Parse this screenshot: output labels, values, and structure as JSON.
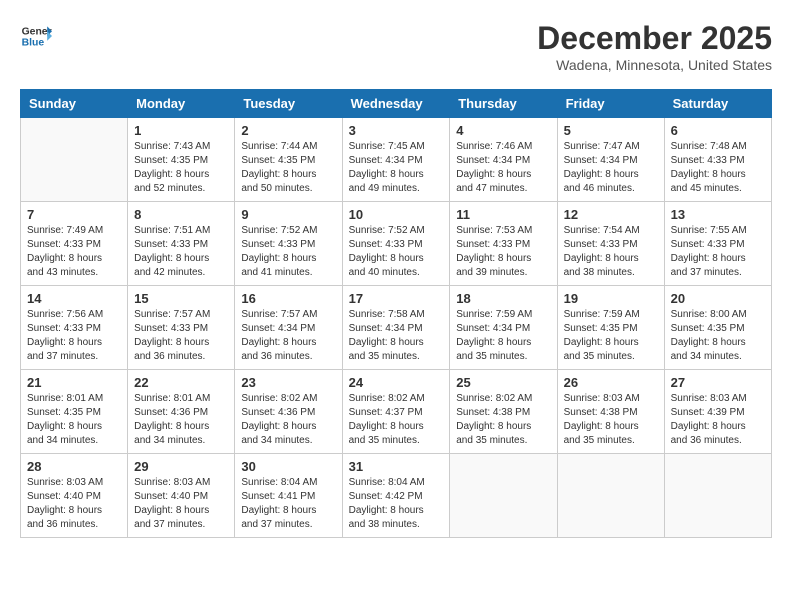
{
  "header": {
    "logo_line1": "General",
    "logo_line2": "Blue",
    "title": "December 2025",
    "subtitle": "Wadena, Minnesota, United States"
  },
  "weekdays": [
    "Sunday",
    "Monday",
    "Tuesday",
    "Wednesday",
    "Thursday",
    "Friday",
    "Saturday"
  ],
  "weeks": [
    [
      {
        "day": "",
        "info": ""
      },
      {
        "day": "1",
        "info": "Sunrise: 7:43 AM\nSunset: 4:35 PM\nDaylight: 8 hours\nand 52 minutes."
      },
      {
        "day": "2",
        "info": "Sunrise: 7:44 AM\nSunset: 4:35 PM\nDaylight: 8 hours\nand 50 minutes."
      },
      {
        "day": "3",
        "info": "Sunrise: 7:45 AM\nSunset: 4:34 PM\nDaylight: 8 hours\nand 49 minutes."
      },
      {
        "day": "4",
        "info": "Sunrise: 7:46 AM\nSunset: 4:34 PM\nDaylight: 8 hours\nand 47 minutes."
      },
      {
        "day": "5",
        "info": "Sunrise: 7:47 AM\nSunset: 4:34 PM\nDaylight: 8 hours\nand 46 minutes."
      },
      {
        "day": "6",
        "info": "Sunrise: 7:48 AM\nSunset: 4:33 PM\nDaylight: 8 hours\nand 45 minutes."
      }
    ],
    [
      {
        "day": "7",
        "info": "Sunrise: 7:49 AM\nSunset: 4:33 PM\nDaylight: 8 hours\nand 43 minutes."
      },
      {
        "day": "8",
        "info": "Sunrise: 7:51 AM\nSunset: 4:33 PM\nDaylight: 8 hours\nand 42 minutes."
      },
      {
        "day": "9",
        "info": "Sunrise: 7:52 AM\nSunset: 4:33 PM\nDaylight: 8 hours\nand 41 minutes."
      },
      {
        "day": "10",
        "info": "Sunrise: 7:52 AM\nSunset: 4:33 PM\nDaylight: 8 hours\nand 40 minutes."
      },
      {
        "day": "11",
        "info": "Sunrise: 7:53 AM\nSunset: 4:33 PM\nDaylight: 8 hours\nand 39 minutes."
      },
      {
        "day": "12",
        "info": "Sunrise: 7:54 AM\nSunset: 4:33 PM\nDaylight: 8 hours\nand 38 minutes."
      },
      {
        "day": "13",
        "info": "Sunrise: 7:55 AM\nSunset: 4:33 PM\nDaylight: 8 hours\nand 37 minutes."
      }
    ],
    [
      {
        "day": "14",
        "info": "Sunrise: 7:56 AM\nSunset: 4:33 PM\nDaylight: 8 hours\nand 37 minutes."
      },
      {
        "day": "15",
        "info": "Sunrise: 7:57 AM\nSunset: 4:33 PM\nDaylight: 8 hours\nand 36 minutes."
      },
      {
        "day": "16",
        "info": "Sunrise: 7:57 AM\nSunset: 4:34 PM\nDaylight: 8 hours\nand 36 minutes."
      },
      {
        "day": "17",
        "info": "Sunrise: 7:58 AM\nSunset: 4:34 PM\nDaylight: 8 hours\nand 35 minutes."
      },
      {
        "day": "18",
        "info": "Sunrise: 7:59 AM\nSunset: 4:34 PM\nDaylight: 8 hours\nand 35 minutes."
      },
      {
        "day": "19",
        "info": "Sunrise: 7:59 AM\nSunset: 4:35 PM\nDaylight: 8 hours\nand 35 minutes."
      },
      {
        "day": "20",
        "info": "Sunrise: 8:00 AM\nSunset: 4:35 PM\nDaylight: 8 hours\nand 34 minutes."
      }
    ],
    [
      {
        "day": "21",
        "info": "Sunrise: 8:01 AM\nSunset: 4:35 PM\nDaylight: 8 hours\nand 34 minutes."
      },
      {
        "day": "22",
        "info": "Sunrise: 8:01 AM\nSunset: 4:36 PM\nDaylight: 8 hours\nand 34 minutes."
      },
      {
        "day": "23",
        "info": "Sunrise: 8:02 AM\nSunset: 4:36 PM\nDaylight: 8 hours\nand 34 minutes."
      },
      {
        "day": "24",
        "info": "Sunrise: 8:02 AM\nSunset: 4:37 PM\nDaylight: 8 hours\nand 35 minutes."
      },
      {
        "day": "25",
        "info": "Sunrise: 8:02 AM\nSunset: 4:38 PM\nDaylight: 8 hours\nand 35 minutes."
      },
      {
        "day": "26",
        "info": "Sunrise: 8:03 AM\nSunset: 4:38 PM\nDaylight: 8 hours\nand 35 minutes."
      },
      {
        "day": "27",
        "info": "Sunrise: 8:03 AM\nSunset: 4:39 PM\nDaylight: 8 hours\nand 36 minutes."
      }
    ],
    [
      {
        "day": "28",
        "info": "Sunrise: 8:03 AM\nSunset: 4:40 PM\nDaylight: 8 hours\nand 36 minutes."
      },
      {
        "day": "29",
        "info": "Sunrise: 8:03 AM\nSunset: 4:40 PM\nDaylight: 8 hours\nand 37 minutes."
      },
      {
        "day": "30",
        "info": "Sunrise: 8:04 AM\nSunset: 4:41 PM\nDaylight: 8 hours\nand 37 minutes."
      },
      {
        "day": "31",
        "info": "Sunrise: 8:04 AM\nSunset: 4:42 PM\nDaylight: 8 hours\nand 38 minutes."
      },
      {
        "day": "",
        "info": ""
      },
      {
        "day": "",
        "info": ""
      },
      {
        "day": "",
        "info": ""
      }
    ]
  ]
}
